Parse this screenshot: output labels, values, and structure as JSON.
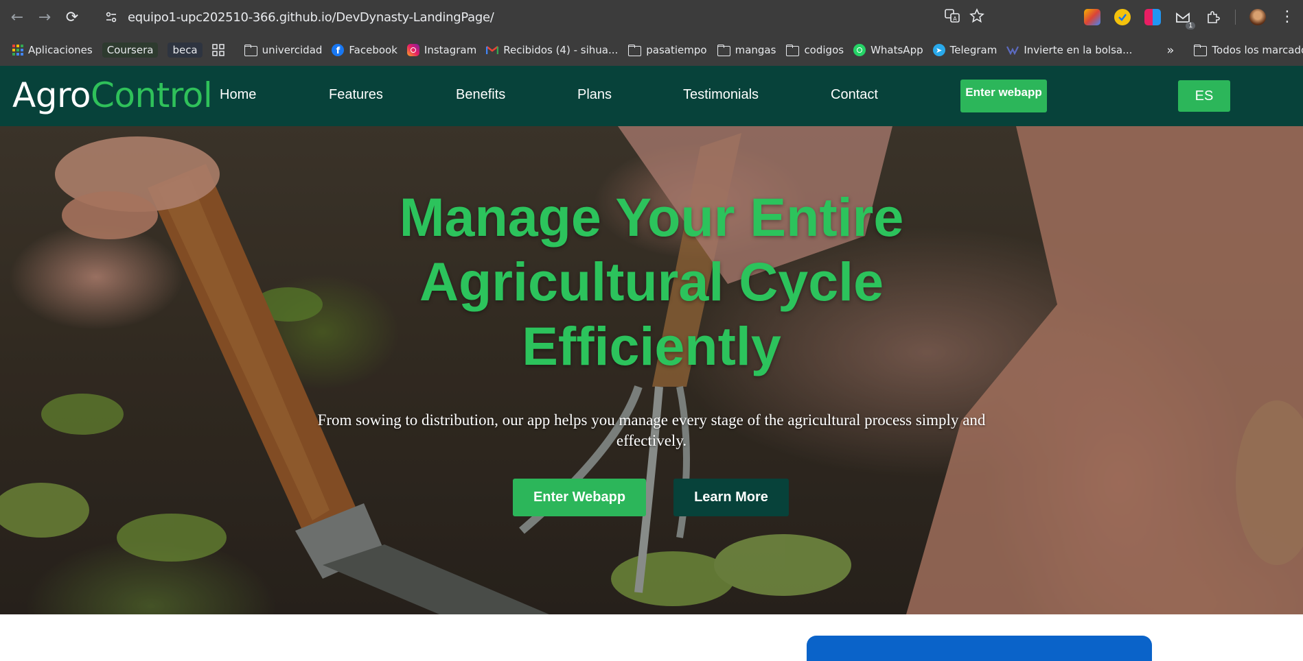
{
  "browser": {
    "url": "equipo1-upc202510-366.github.io/DevDynasty-LandingPage/",
    "nav_icons": [
      "back-icon",
      "forward-icon",
      "reload-icon"
    ],
    "extension_badge": "1",
    "bookmarks": [
      {
        "label": "Aplicaciones",
        "icon": "apps-grid-icon"
      },
      {
        "label": "Coursera",
        "icon": "coursera-chip"
      },
      {
        "label": "beca",
        "icon": "beca-chip"
      },
      {
        "label": "univercidad",
        "icon": "folder-icon"
      },
      {
        "label": "Facebook",
        "icon": "facebook-icon"
      },
      {
        "label": "Instagram",
        "icon": "instagram-icon"
      },
      {
        "label": "Recibidos (4) - sihua...",
        "icon": "gmail-icon"
      },
      {
        "label": "pasatiempo",
        "icon": "folder-icon"
      },
      {
        "label": "mangas",
        "icon": "folder-icon"
      },
      {
        "label": "codigos",
        "icon": "folder-icon"
      },
      {
        "label": "WhatsApp",
        "icon": "whatsapp-icon"
      },
      {
        "label": "Telegram",
        "icon": "telegram-icon"
      },
      {
        "label": "Invierte en la bolsa...",
        "icon": "invest-icon"
      }
    ],
    "all_bookmarks_label": "Todos los marcadores"
  },
  "site": {
    "logo_part1": "Agro",
    "logo_part2": "Control",
    "nav": [
      "Home",
      "Features",
      "Benefits",
      "Plans",
      "Testimonials",
      "Contact"
    ],
    "enter_webapp_label": "Enter webapp",
    "lang_label": "ES"
  },
  "hero": {
    "title": "Manage Your Entire Agricultural Cycle Efficiently",
    "subtitle": "From sowing to distribution, our app helps you manage every stage of the agricultural process simply and effectively.",
    "primary_button": "Enter Webapp",
    "secondary_button": "Learn More"
  },
  "colors": {
    "header_bg": "#07423a",
    "accent_green": "#2cb65a",
    "title_green": "#2cc35c",
    "card_blue": "#0a63c9",
    "chrome_bg": "#3c3c3c"
  }
}
